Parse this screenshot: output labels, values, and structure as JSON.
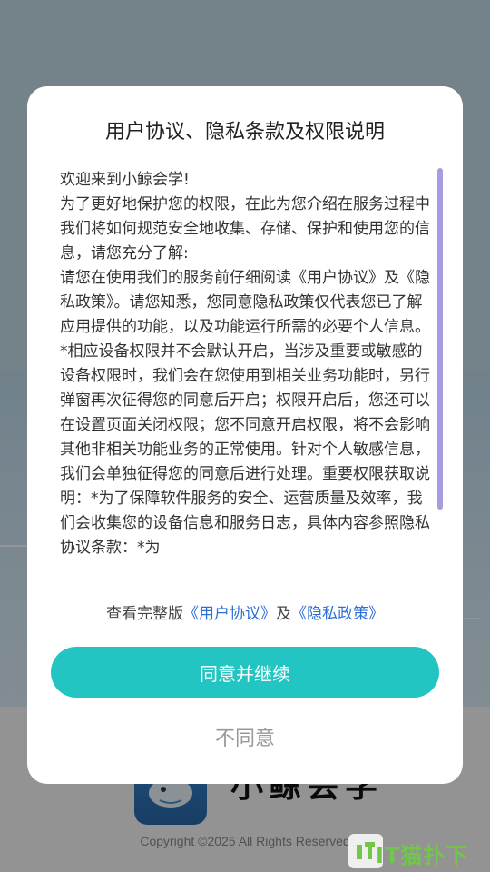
{
  "dialog": {
    "title": "用户协议、隐私条款及权限说明",
    "paragraphs": [
      "欢迎来到小鲸会学!",
      "为了更好地保护您的权限，在此为您介绍在服务过程中我们将如何规范安全地收集、存储、保护和使用您的信息，请您充分了解:",
      "请您在使用我们的服务前仔细阅读《用户协议》及《隐私政策》。请您知悉，您同意隐私政策仅代表您已了解应用提供的功能，以及功能运行所需的必要个人信息。",
      "*相应设备权限并不会默认开启，当涉及重要或敏感的设备权限时，我们会在您使用到相关业务功能时，另行弹窗再次征得您的同意后开启；权限开启后，您还可以在设置页面关闭权限；您不同意开启权限，将不会影响其他非相关功能业务的正常使用。针对个人敏感信息，我们会单独征得您的同意后进行处理。重要权限获取说明：*为了保障软件服务的安全、运营质量及效率，我们会收集您的设备信息和服务日志，具体内容参照隐私协议条款：*为"
    ],
    "links_prefix": "查看完整版",
    "link_user_agreement": "《用户协议》",
    "links_and": "及",
    "link_privacy_policy": "《隐私政策》",
    "agree_label": "同意并继续",
    "disagree_label": "不同意"
  },
  "background": {
    "app_name": "小鲸会学",
    "copyright": "Copyright ©2025 All Rights Reserved"
  },
  "watermark": {
    "text": "IT猫扑下载"
  },
  "colors": {
    "accent": "#22c5c2",
    "link": "#2e6fd6",
    "scrollbar": "#a99be0"
  }
}
